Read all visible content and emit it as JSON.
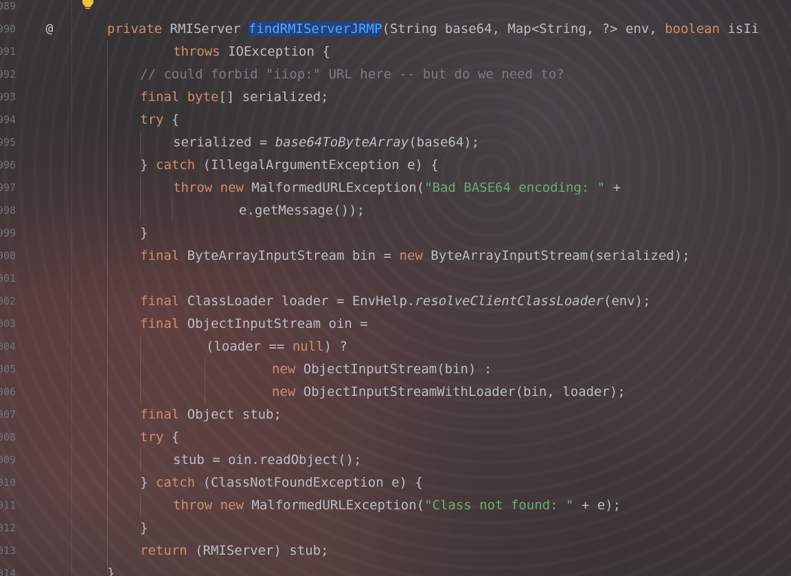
{
  "gutter": {
    "line_numbers": [
      "989",
      "990",
      "991",
      "992",
      "993",
      "994",
      "995",
      "996",
      "997",
      "998",
      "999",
      "000",
      "001",
      "002",
      "003",
      "004",
      "005",
      "006",
      "007",
      "008",
      "009",
      "010",
      "011",
      "012",
      "013",
      "014"
    ]
  },
  "icons": {
    "gutter_marker": "@",
    "bulb": "lightbulb-icon"
  },
  "colors": {
    "keyword": "#cf8e6d",
    "string": "#6aab73",
    "comment": "#7a7e85",
    "text": "#bcbec4",
    "selection": "#214283",
    "method_highlight": "#56a8f5"
  },
  "code": {
    "l990": {
      "t1": "private",
      "t2": " RMIServer ",
      "t3": "findRMIServerJRMP",
      "t4": "(String base64, Map<String, ?> env, ",
      "t5": "boolean",
      "t6": " isIi"
    },
    "l991": {
      "t1": "throws",
      "t2": " IOException {"
    },
    "l992": {
      "t1": "// could forbid \"iiop:\" URL here -- but do we need to?"
    },
    "l993": {
      "t1": "final",
      "t2": " ",
      "t3": "byte",
      "t4": "[] serialized;"
    },
    "l994": {
      "t1": "try",
      "t2": " {"
    },
    "l995": {
      "t1": "serialized = ",
      "t2": "base64ToByteArray",
      "t3": "(base64);"
    },
    "l996": {
      "t1": "} ",
      "t2": "catch",
      "t3": " (IllegalArgumentException e) {"
    },
    "l997": {
      "t1": "throw",
      "t2": " ",
      "t3": "new",
      "t4": " MalformedURLException(",
      "t5": "\"Bad BASE64 encoding: \"",
      "t6": " +"
    },
    "l998": {
      "t1": "e.getMessage());"
    },
    "l999": {
      "t1": "}"
    },
    "l000": {
      "t1": "final",
      "t2": " ByteArrayInputStream bin = ",
      "t3": "new",
      "t4": " ByteArrayInputStream(serialized);"
    },
    "l002": {
      "t1": "final",
      "t2": " ClassLoader loader = EnvHelp.",
      "t3": "resolveClientClassLoader",
      "t4": "(env);"
    },
    "l003": {
      "t1": "final",
      "t2": " ObjectInputStream oin ="
    },
    "l004": {
      "t1": "(loader == ",
      "t2": "null",
      "t3": ") ?"
    },
    "l005": {
      "t1": "new",
      "t2": " ObjectInputStream(bin) :"
    },
    "l006": {
      "t1": "new",
      "t2": " ObjectInputStreamWithLoader(bin, loader);"
    },
    "l007": {
      "t1": "final",
      "t2": " Object stub;"
    },
    "l008": {
      "t1": "try",
      "t2": " {"
    },
    "l009": {
      "t1": "stub = oin.readObject();"
    },
    "l010": {
      "t1": "} ",
      "t2": "catch",
      "t3": " (ClassNotFoundException e) {"
    },
    "l011": {
      "t1": "throw",
      "t2": " ",
      "t3": "new",
      "t4": " MalformedURLException(",
      "t5": "\"Class not found: \"",
      "t6": " + e);"
    },
    "l012": {
      "t1": "}"
    },
    "l013": {
      "t1": "return",
      "t2": " (RMIServer) stub;"
    },
    "l014": {
      "t1": "}"
    }
  }
}
